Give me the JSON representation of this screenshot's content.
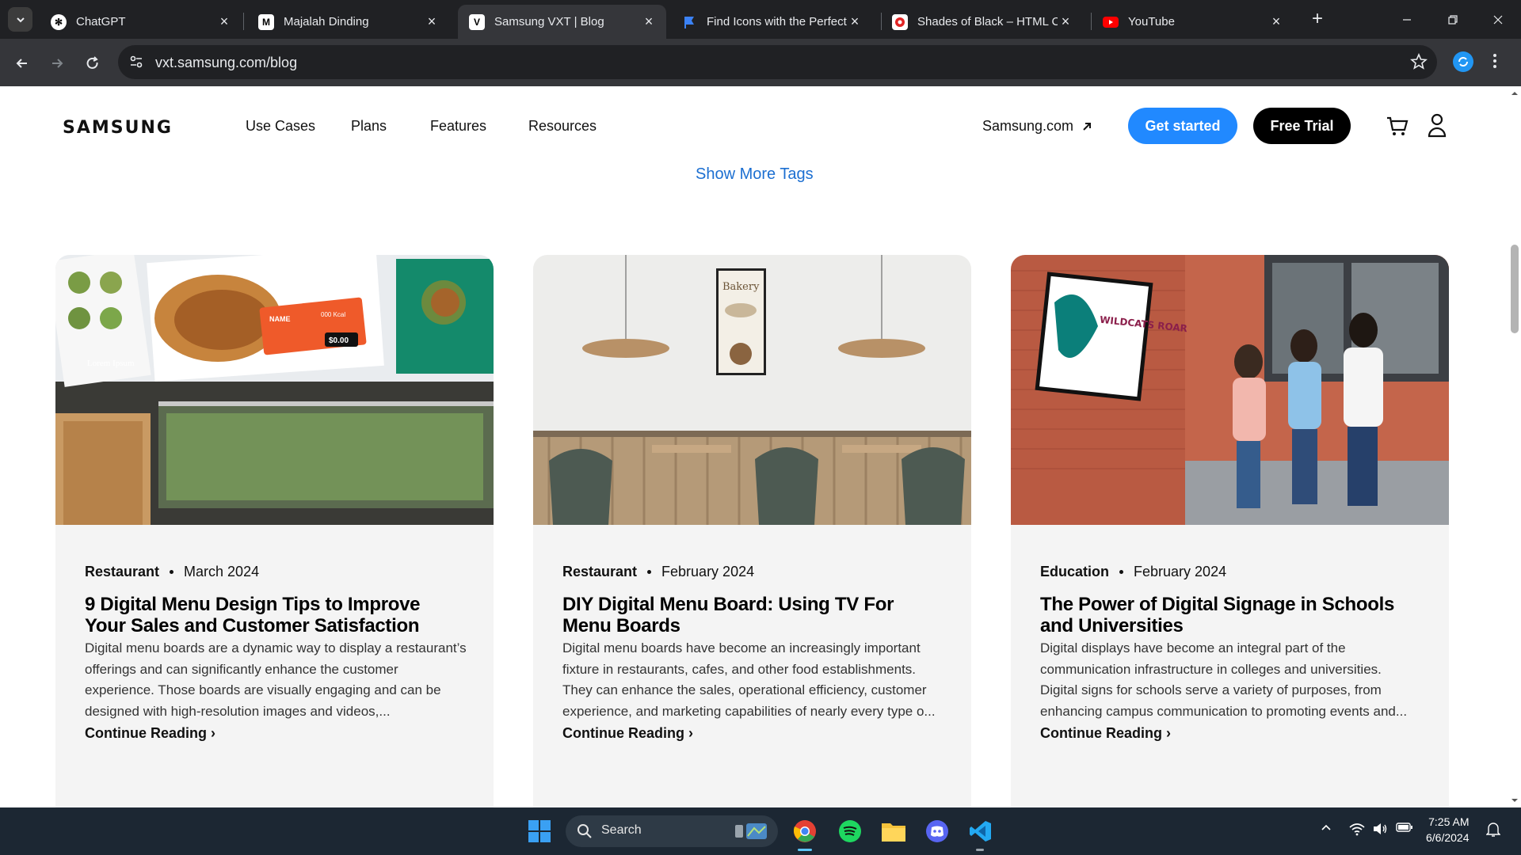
{
  "browser": {
    "tabs": [
      {
        "title": "ChatGPT"
      },
      {
        "title": "Majalah Dinding"
      },
      {
        "title": "Samsung VXT | Blog"
      },
      {
        "title": "Find Icons with the Perfect"
      },
      {
        "title": "Shades of Black – HTML Co"
      },
      {
        "title": "YouTube"
      }
    ],
    "url": "vxt.samsung.com/blog"
  },
  "header": {
    "logo": "SAMSUNG",
    "nav": [
      "Use Cases",
      "Plans",
      "Features",
      "Resources"
    ],
    "samsung_link": "Samsung.com",
    "get_started": "Get started",
    "free_trial": "Free Trial"
  },
  "show_more": "Show More Tags",
  "cards": [
    {
      "category": "Restaurant",
      "date": "March 2024",
      "title": "9 Digital Menu Design Tips to Improve Your Sales and Customer Satisfaction",
      "excerpt": "Digital menu boards are a dynamic way to display a restaurant’s offerings and can significantly enhance the customer experience. Those boards are visually engaging and can be designed with high-resolution images and videos,...",
      "more": "Continue Reading ›",
      "image_text": {
        "price": "$0.00",
        "name": "NAME",
        "kcal": "000 Kcal",
        "lorem": "Lorem Ipsum"
      }
    },
    {
      "category": "Restaurant",
      "date": "February 2024",
      "title": "DIY Digital Menu Board: Using TV For Menu Boards",
      "excerpt": "Digital menu boards have become an increasingly important fixture in restaurants, cafes, and other food establishments. They can enhance the sales, operational efficiency, customer experience, and marketing capabilities of nearly every type o...",
      "more": "Continue Reading ›",
      "image_text": {
        "poster_title": "Bakery"
      }
    },
    {
      "category": "Education",
      "date": "February 2024",
      "title": "The Power of Digital Signage in Schools and Universities",
      "excerpt": "Digital displays have become an integral part of the communication infrastructure in colleges and universities. Digital signs for schools serve a variety of purposes, from enhancing campus communication to promoting events and...",
      "more": "Continue Reading ›",
      "image_text": {
        "poster_title": "WILDCATS ROAR"
      }
    }
  ],
  "taskbar": {
    "search": "Search",
    "time": "7:25 AM",
    "date": "6/6/2024"
  }
}
